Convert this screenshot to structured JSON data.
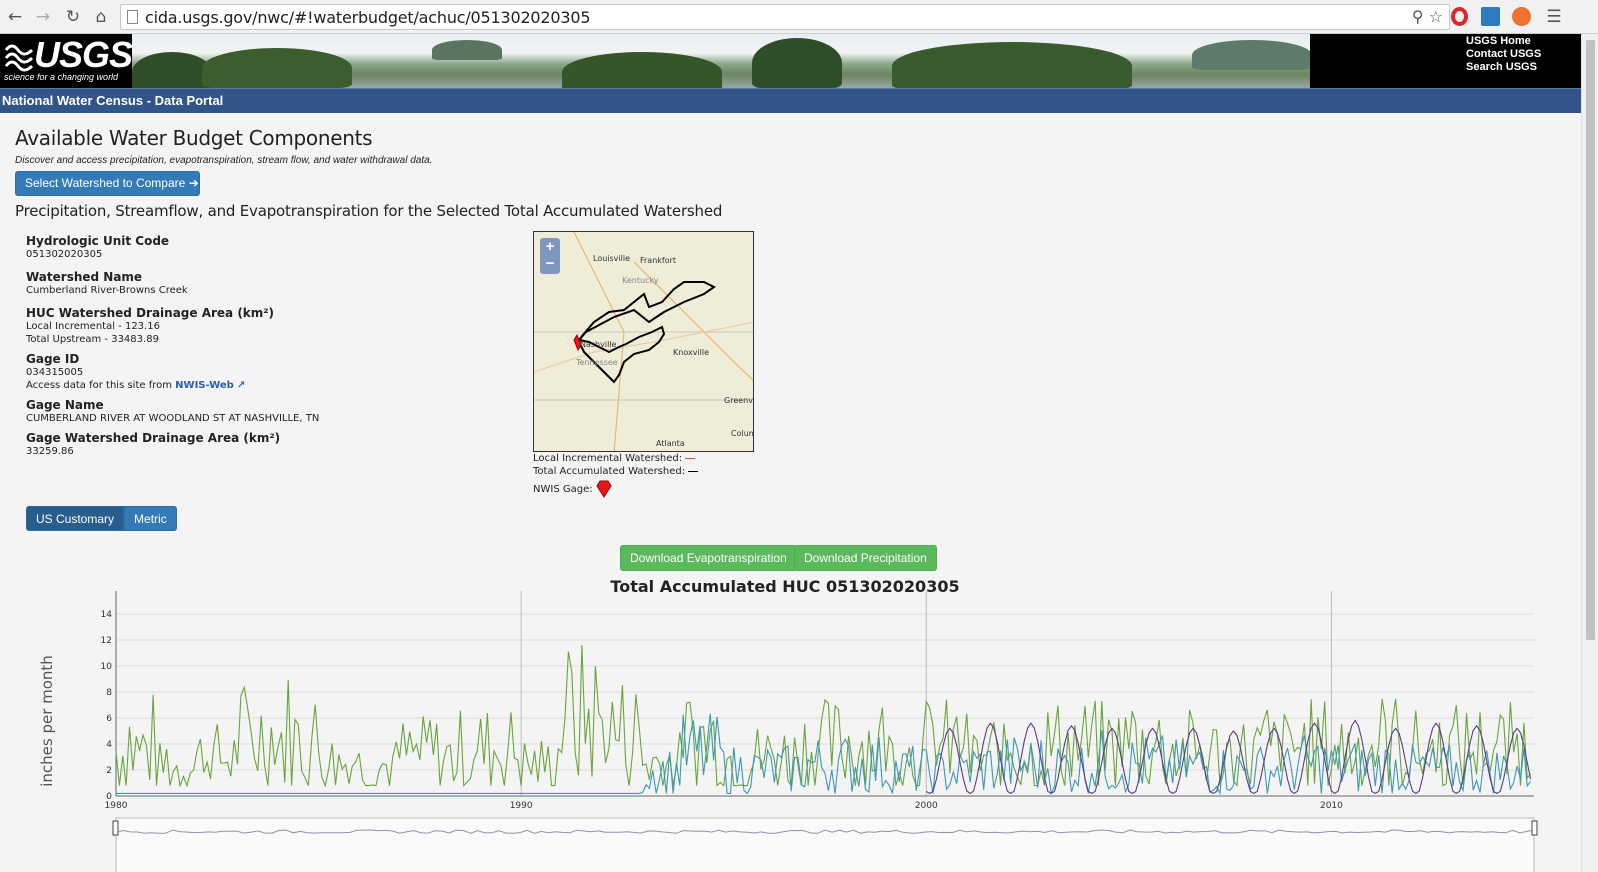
{
  "browser": {
    "url": "cida.usgs.gov/nwc/#!waterbudget/achuc/051302020305",
    "back_icon": "back-arrow-icon",
    "forward_icon": "forward-arrow-icon",
    "reload_icon": "reload-icon",
    "home_icon": "home-icon"
  },
  "header": {
    "logo_text": "USGS",
    "logo_tagline": "science for a changing world",
    "links": [
      "USGS Home",
      "Contact USGS",
      "Search USGS"
    ],
    "portal_title": "National Water Census - Data Portal"
  },
  "page": {
    "title": "Available Water Budget Components",
    "subtitle": "Discover and access precipitation, evapotranspiration, stream flow, and water withdrawal data.",
    "compare_button": "Select Watershed to Compare ➔",
    "section_title": "Precipitation, Streamflow, and Evapotranspiration for the Selected Total Accumulated Watershed"
  },
  "info": {
    "huc_label": "Hydrologic Unit Code",
    "huc_value": "051302020305",
    "watershed_name_label": "Watershed Name",
    "watershed_name_value": "Cumberland River-Browns Creek",
    "drainage_label": "HUC Watershed Drainage Area (km²)",
    "local_incremental": "Local Incremental - 123.16",
    "total_upstream": "Total Upstream - 33483.89",
    "gage_id_label": "Gage ID",
    "gage_id_value": "034315005",
    "access_text": "Access data for this site from",
    "access_link": "NWIS-Web",
    "gage_name_label": "Gage Name",
    "gage_name_value": "CUMBERLAND RIVER AT WOODLAND ST AT NASHVILLE, TN",
    "gage_drainage_label": "Gage Watershed Drainage Area (km²)",
    "gage_drainage_value": "33259.86"
  },
  "map": {
    "zoom_in": "+",
    "zoom_out": "−",
    "labels": [
      "Louisville",
      "Frankfort",
      "Kentucky",
      "Nashville",
      "Tennessee",
      "Knoxville",
      "Greenvi",
      "Colum",
      "Atlanta"
    ]
  },
  "legend": {
    "local": "Local Incremental Watershed:",
    "total": "Total Accumulated Watershed:",
    "gage": "NWIS Gage:",
    "local_color": "#d9534f",
    "total_color": "#000000",
    "gage_color": "#e8151b"
  },
  "units": {
    "us": "US Customary",
    "metric": "Metric"
  },
  "downloads": {
    "et": "Download Evapotranspiration",
    "precip": "Download Precipitation"
  },
  "chart_title": "Total Accumulated HUC 051302020305",
  "chart_data": {
    "type": "line",
    "title": "Total Accumulated HUC 051302020305",
    "ylabel": "inches per month",
    "xlabel": "",
    "x_ticks": [
      "1980",
      "1990",
      "2000",
      "2010"
    ],
    "y_ticks": [
      "0",
      "2",
      "4",
      "6",
      "8",
      "10",
      "12",
      "14"
    ],
    "ylim": [
      0,
      15
    ],
    "xlim": [
      1980,
      2015
    ],
    "grid": true,
    "series_colors": [
      "#6aa33e",
      "#3d98b3",
      "#5a3b87"
    ],
    "series": [
      {
        "values_per_year_max": [
          8.2,
          5.0,
          6.8,
          10.6,
          9.8,
          6.0,
          5.4,
          7.4,
          6.8,
          8.4,
          5.6,
          14.2,
          11.3,
          6.0,
          10.0,
          6.8,
          7.0,
          9.0,
          9.5,
          7.2,
          9.0,
          6.6,
          7.0,
          9.0,
          8.8,
          9.0,
          8.0,
          7.5,
          8.0,
          9.0,
          8.5,
          9.6,
          8.0,
          8.6,
          8.6
        ],
        "x_start": 1980
      },
      {
        "values_per_year_max": [
          0.2,
          0.2,
          0.2,
          0.2,
          0.2,
          0.2,
          0.2,
          0.2,
          0.2,
          0.2,
          0.2,
          0.2,
          0.2,
          4.8,
          8.0,
          5.0,
          5.0,
          6.0,
          6.0,
          5.0,
          4.5,
          5.5,
          6.0,
          5.5,
          6.5,
          6.0,
          5.5,
          5.0,
          5.0,
          6.0,
          5.5,
          5.5,
          5.0,
          5.0,
          5.0
        ],
        "x_start": 1980
      },
      {
        "values_per_year_max": [
          5.2,
          5.6,
          5.6,
          5.4,
          5.2,
          5.2,
          5.2,
          5.0,
          5.2,
          5.6,
          5.8,
          5.2,
          5.6,
          5.4,
          5.2
        ],
        "x_start": 2000
      }
    ]
  }
}
